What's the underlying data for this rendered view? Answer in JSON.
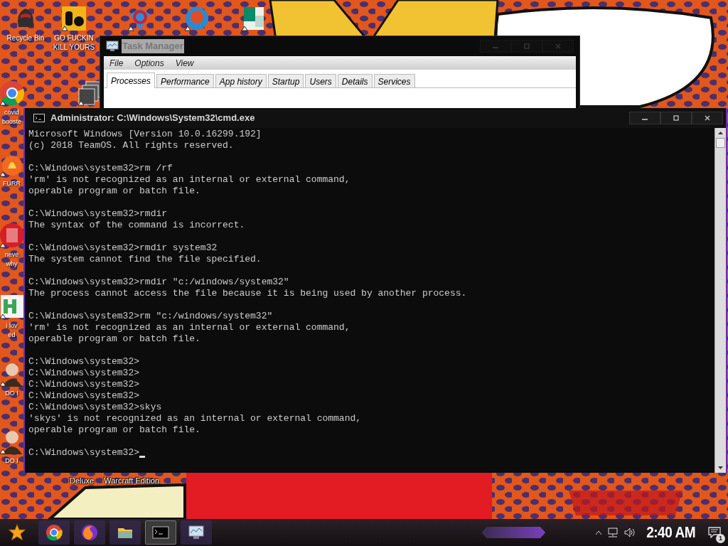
{
  "desktop": {
    "icons": [
      {
        "kind": "bin",
        "lines": [
          "Recycle Bin"
        ]
      },
      {
        "kind": "yellow",
        "lines": [
          "GO FUCKIN",
          "KILL YOURS"
        ]
      },
      {
        "kind": "gem"
      },
      {
        "kind": "circle"
      },
      {
        "kind": "doc"
      },
      {
        "kind": "browser",
        "lines": [
          "covid",
          "booste"
        ]
      },
      {
        "kind": "stack"
      },
      {
        "kind": "flame",
        "lines": [
          "FURR"
        ]
      },
      {
        "kind": "red",
        "lines": [
          "neve",
          "why"
        ]
      },
      {
        "kind": "green",
        "lines": [
          "i lov",
          "ed"
        ]
      },
      {
        "kind": "figure",
        "lines": [
          "DO I"
        ]
      },
      {
        "kind": "figure",
        "lines": [
          "DO I"
        ]
      }
    ],
    "bottom_labels": [
      "Deluxe",
      "Warcraft Edition"
    ]
  },
  "task_manager": {
    "title": "Task Manager",
    "menu": [
      "File",
      "Options",
      "View"
    ],
    "tabs": [
      {
        "label": "Processes",
        "selected": true
      },
      {
        "label": "Performance",
        "selected": false
      },
      {
        "label": "App history",
        "selected": false
      },
      {
        "label": "Startup",
        "selected": false
      },
      {
        "label": "Users",
        "selected": false
      },
      {
        "label": "Details",
        "selected": false
      },
      {
        "label": "Services",
        "selected": false
      }
    ]
  },
  "console": {
    "title": "Administrator: C:\\Windows\\System32\\cmd.exe",
    "cursor": true,
    "blocks": [
      [
        "Microsoft Windows [Version 10.0.16299.192]",
        "(c) 2018 TeamOS. All rights reserved."
      ],
      [
        "C:\\Windows\\system32>rm /rf",
        "'rm' is not recognized as an internal or external command,",
        "operable program or batch file."
      ],
      [
        "C:\\Windows\\system32>rmdir",
        "The syntax of the command is incorrect."
      ],
      [
        "C:\\Windows\\system32>rmdir system32",
        "The system cannot find the file specified."
      ],
      [
        "C:\\Windows\\system32>rmdir \"c:/windows/system32\"",
        "The process cannot access the file because it is being used by another process."
      ],
      [
        "C:\\Windows\\system32>rm \"c:/windows/system32\"",
        "'rm' is not recognized as an internal or external command,",
        "operable program or batch file."
      ],
      [
        "C:\\Windows\\system32>",
        "C:\\Windows\\system32>",
        "C:\\Windows\\system32>",
        "C:\\Windows\\system32>",
        "C:\\Windows\\system32>skys",
        "'skys' is not recognized as an internal or external command,",
        "operable program or batch file."
      ],
      [
        "C:\\Windows\\system32>"
      ]
    ]
  },
  "taskbar": {
    "apps": [
      {
        "kind": "browser",
        "active": false
      },
      {
        "kind": "firefox",
        "active": false
      },
      {
        "kind": "folder",
        "active": false
      },
      {
        "kind": "console",
        "active": true
      },
      {
        "kind": "monitor",
        "active": false
      }
    ],
    "clock": "2:40 AM",
    "notifications": "1"
  }
}
